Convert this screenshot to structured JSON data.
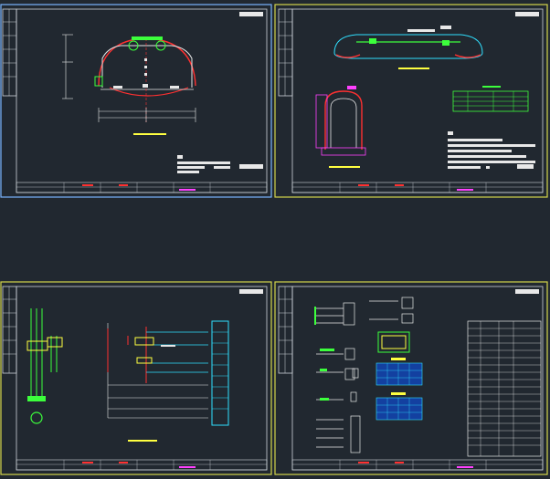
{
  "canvas": {
    "background": "#212830",
    "accents": {
      "border_blue": "#7ab4ff",
      "border_yellow": "#d4d64a",
      "white": "#e8e8e8",
      "red": "#ff3030",
      "green": "#3cff3c",
      "cyan": "#30e0ff",
      "magenta": "#ff40ff",
      "yellow": "#ffff40"
    }
  },
  "viewports": [
    {
      "id": "tunnel-section-view",
      "active": true
    },
    {
      "id": "tunnel-profile-view",
      "active": false
    },
    {
      "id": "control-circuit-view",
      "active": false
    },
    {
      "id": "component-schedule-view",
      "active": false
    }
  ]
}
